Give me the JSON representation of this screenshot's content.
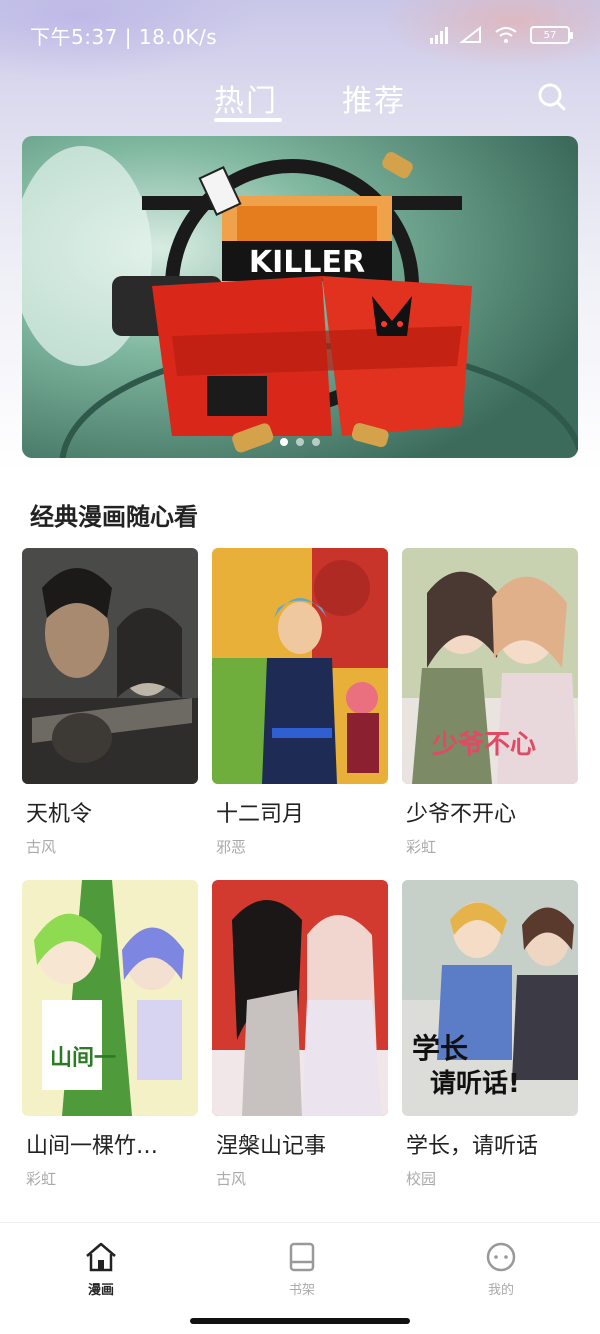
{
  "status_bar": {
    "time_and_speed": "下午5:37 | 18.0K/s",
    "battery": "57"
  },
  "tabs": [
    {
      "label": "热门",
      "active": true
    },
    {
      "label": "推荐",
      "active": false
    }
  ],
  "banner": {
    "title_art": "KILLER",
    "page_count": 3,
    "active_page": 1
  },
  "section": {
    "title": "经典漫画随心看"
  },
  "comics": [
    {
      "title": "天机令",
      "tag": "古风"
    },
    {
      "title": "十二司月",
      "tag": "邪恶"
    },
    {
      "title": "少爷不开心",
      "tag": "彩虹"
    },
    {
      "title": "山间一棵竹…",
      "tag": "彩虹"
    },
    {
      "title": "涅槃山记事",
      "tag": "古风"
    },
    {
      "title": "学长，请听话",
      "tag": "校园"
    }
  ],
  "nav": [
    {
      "label": "漫画",
      "icon": "home-icon",
      "active": true
    },
    {
      "label": "书架",
      "icon": "bookshelf-icon",
      "active": false
    },
    {
      "label": "我的",
      "icon": "profile-icon",
      "active": false
    }
  ],
  "colors": {
    "active_text": "#222222",
    "inactive_text": "#aaaaaa",
    "tab_text": "#ffffff"
  }
}
